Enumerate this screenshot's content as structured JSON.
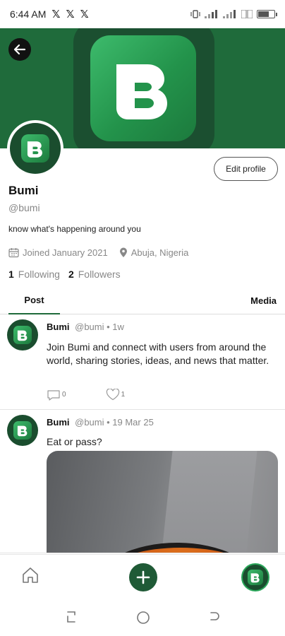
{
  "status_bar": {
    "time": "6:44 AM",
    "notification_icons": [
      "𝕏",
      "𝕏",
      "𝕏"
    ],
    "battery_level": 0.75
  },
  "header": {
    "back_icon": "arrow-left-icon",
    "banner_logo_letter": "B"
  },
  "profile": {
    "avatar_letter": "B",
    "edit_label": "Edit profile",
    "display_name": "Bumi",
    "handle": "@bumi",
    "bio": "know what's happening around you",
    "joined": "Joined January 2021",
    "location": "Abuja, Nigeria",
    "following_count": "1",
    "following_label": "Following",
    "followers_count": "2",
    "followers_label": "Followers"
  },
  "tabs": [
    {
      "label": "Post",
      "active": true
    },
    {
      "label": "Media",
      "active": false
    }
  ],
  "posts": [
    {
      "author": "Bumi",
      "meta": "@bumi • 1w",
      "text": "Join Bumi and connect with users from around the world, sharing stories, ideas, and news that matter.",
      "comments": "0",
      "likes": "1"
    },
    {
      "author": "Bumi",
      "meta": "@bumi • 19 Mar 25",
      "text": "Eat or pass?"
    }
  ],
  "colors": {
    "brand_green": "#1f6b3b",
    "brand_dark": "#1a4d2e",
    "accent_light": "#3dbb6c"
  }
}
